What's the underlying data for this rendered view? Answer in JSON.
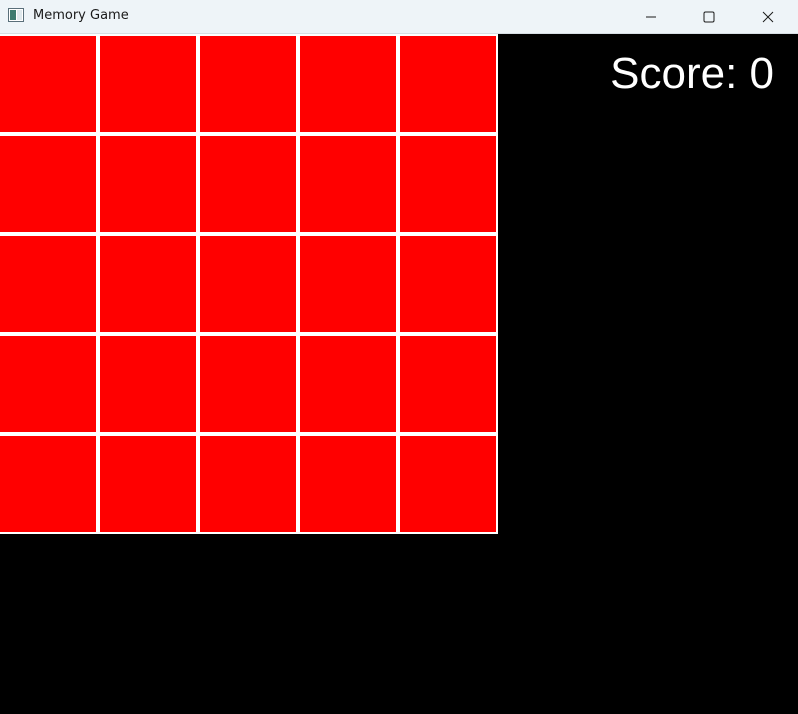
{
  "window": {
    "title": "Memory Game",
    "icon": "app-window-icon",
    "controls": [
      "minimize-icon",
      "maximize-icon",
      "close-icon"
    ]
  },
  "game": {
    "score_text": "Score: 0",
    "score": 0,
    "board": {
      "rows": 5,
      "columns": 5,
      "tile_state": "face-down",
      "tile_color": "#ff0000",
      "border_color": "#ffffff"
    },
    "background_color": "#000000"
  }
}
